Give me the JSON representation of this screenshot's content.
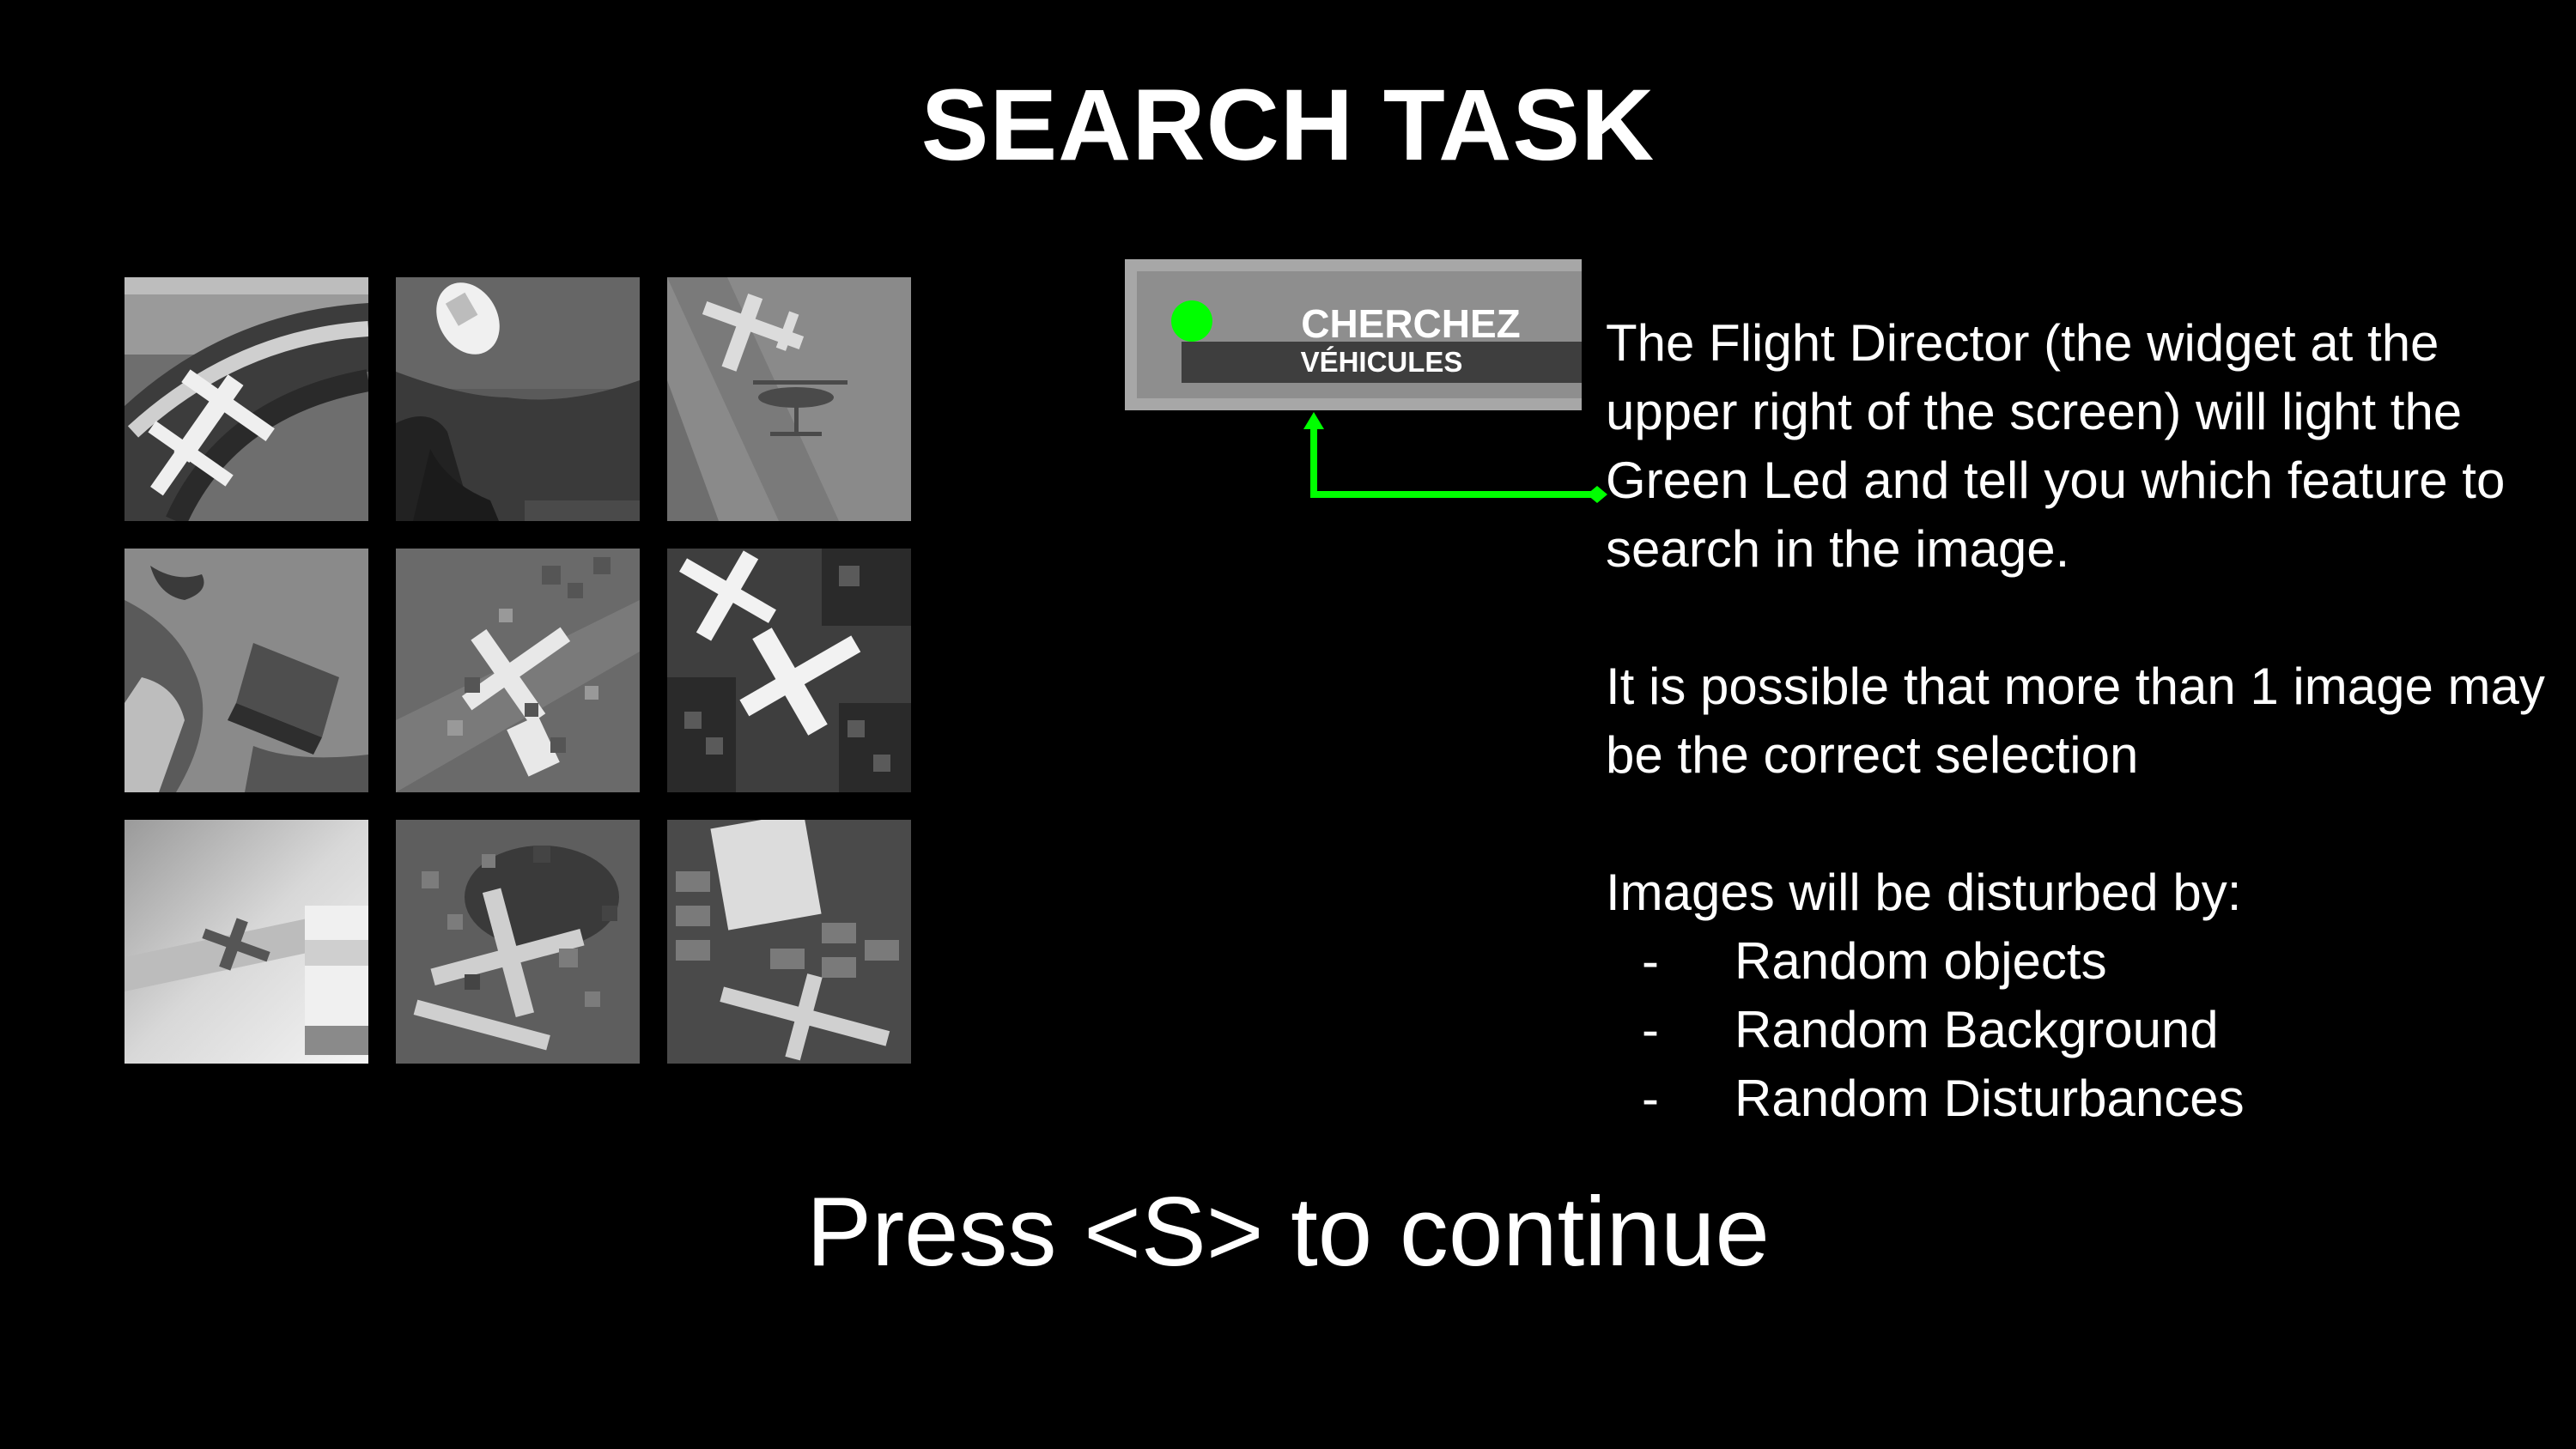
{
  "title": "SEARCH TASK",
  "flight_director": {
    "led_color": "#00ff00",
    "title": "CHERCHEZ",
    "subtitle": "VÉHICULES"
  },
  "instructions": {
    "paragraph1": "The Flight Director (the widget at the upper right of the screen) will light the Green Led and tell you which feature to search in the image.",
    "paragraph2": "It is possible that more than 1 image may be the correct selection",
    "disturb_heading": "Images will be disturbed by:",
    "bullets": [
      {
        "dash": "-",
        "label": "Random objects"
      },
      {
        "dash": "-",
        "label": "Random Background"
      },
      {
        "dash": "-",
        "label": "Random Disturbances"
      }
    ]
  },
  "image_grid": {
    "tiles": [
      {
        "icon": "aircraft-on-circular-track-image"
      },
      {
        "icon": "car-on-road-image"
      },
      {
        "icon": "airplane-and-helicopter-image"
      },
      {
        "icon": "rocky-terrain-with-crate-image"
      },
      {
        "icon": "airplanes-with-noise-patches-image"
      },
      {
        "icon": "airplanes-over-city-image"
      },
      {
        "icon": "jet-and-truck-image"
      },
      {
        "icon": "planes-with-disturbance-blocks-image"
      },
      {
        "icon": "truck-and-plane-in-parking-image"
      }
    ]
  },
  "prompt": "Press <S> to continue",
  "colors": {
    "background": "#000000",
    "arrow": "#00ff00",
    "widget_frame": "#a7a7a7"
  }
}
